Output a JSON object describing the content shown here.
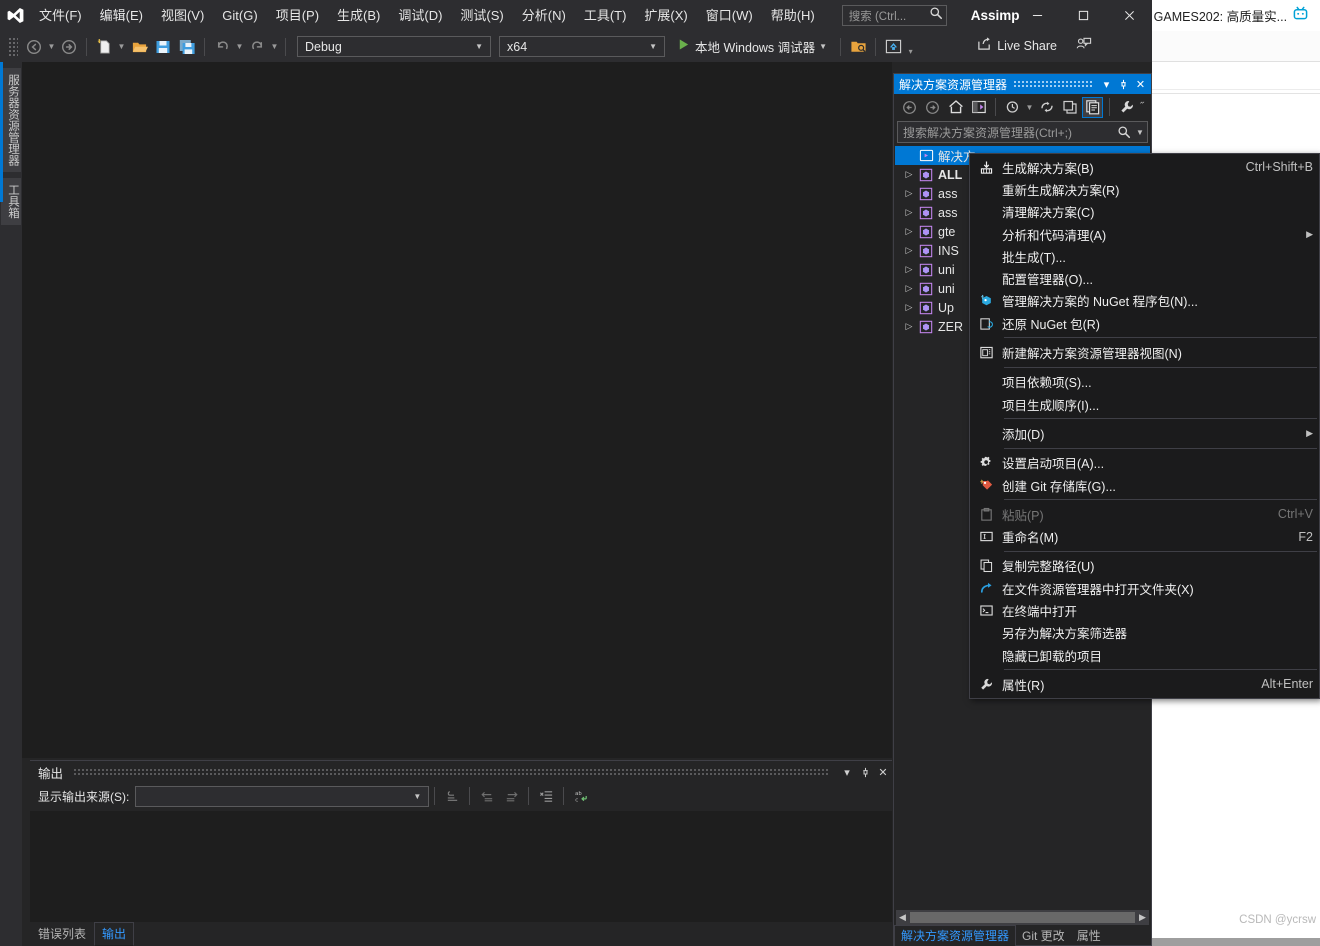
{
  "app": {
    "solution_name": "Assimp",
    "logo_icon": "visual-studio-logo-icon"
  },
  "menu": {
    "items": [
      {
        "label": "文件(F)"
      },
      {
        "label": "编辑(E)"
      },
      {
        "label": "视图(V)"
      },
      {
        "label": "Git(G)"
      },
      {
        "label": "项目(P)"
      },
      {
        "label": "生成(B)"
      },
      {
        "label": "调试(D)"
      },
      {
        "label": "测试(S)"
      },
      {
        "label": "分析(N)"
      },
      {
        "label": "工具(T)"
      },
      {
        "label": "扩展(X)"
      },
      {
        "label": "窗口(W)"
      },
      {
        "label": "帮助(H)"
      }
    ],
    "search_placeholder": "搜索 (Ctrl...",
    "search_icon": "search-icon"
  },
  "window_controls": {
    "minimize": "—",
    "maximize": "□",
    "close": "✕"
  },
  "toolbar": {
    "nav_back_icon": "navigate-back-icon",
    "nav_forward_icon": "navigate-forward-icon",
    "new_item_icon": "new-item-icon",
    "open_file_icon": "open-file-icon",
    "save_icon": "save-icon",
    "save_all_icon": "save-all-icon",
    "undo_icon": "undo-icon",
    "redo_icon": "redo-icon",
    "configuration": "Debug",
    "platform": "x64",
    "run_target": "本地 Windows 调试器",
    "run_icon": "play-icon",
    "select_startup_icon": "startup-project-icon",
    "screenshot_icon": "live-visual-tree-icon",
    "overflow_icon": "toolbar-overflow-icon",
    "live_share": "Live Share",
    "live_share_icon": "live-share-icon",
    "feedback_icon": "send-feedback-icon"
  },
  "left_dock": {
    "tabs": [
      {
        "label": "服务器资源管理器"
      },
      {
        "label": "工具箱"
      }
    ]
  },
  "solution_explorer": {
    "title": "解决方案资源管理器",
    "header_buttons": {
      "dropdown": "▾",
      "pin": "pin-icon",
      "close": "✕"
    },
    "toolbar_icons": [
      "back-icon",
      "forward-icon",
      "home-icon",
      "solution-explorer-icon",
      "pending-changes-icon",
      "refresh-icon",
      "collapse-all-icon",
      "show-all-files-icon",
      "properties-wrench-icon",
      "overflow-icon"
    ],
    "search_placeholder": "搜索解决方案资源管理器(Ctrl+;)",
    "search_icon": "search-icon",
    "search_dropdown_icon": "chevron-down-icon",
    "tree": [
      {
        "label": "解决方",
        "icon": "solution-icon",
        "selected": true,
        "bold": false,
        "expander": ""
      },
      {
        "label": "ALL",
        "icon": "cpp-project-icon",
        "selected": false,
        "bold": true,
        "expander": "▷"
      },
      {
        "label": "ass",
        "icon": "cpp-project-icon",
        "selected": false,
        "bold": false,
        "expander": "▷"
      },
      {
        "label": "ass",
        "icon": "cpp-project-icon",
        "selected": false,
        "bold": false,
        "expander": "▷"
      },
      {
        "label": "gte",
        "icon": "cpp-project-icon",
        "selected": false,
        "bold": false,
        "expander": "▷"
      },
      {
        "label": "INS",
        "icon": "cpp-project-icon",
        "selected": false,
        "bold": false,
        "expander": "▷"
      },
      {
        "label": "uni",
        "icon": "cpp-project-icon",
        "selected": false,
        "bold": false,
        "expander": "▷"
      },
      {
        "label": "uni",
        "icon": "cpp-project-icon",
        "selected": false,
        "bold": false,
        "expander": "▷"
      },
      {
        "label": "Up",
        "icon": "cpp-project-icon",
        "selected": false,
        "bold": false,
        "expander": "▷"
      },
      {
        "label": "ZER",
        "icon": "cpp-project-icon",
        "selected": false,
        "bold": false,
        "expander": "▷"
      }
    ],
    "hscroll": {
      "left_arrow": "◀",
      "right_arrow": "▶"
    },
    "tabs": [
      {
        "label": "解决方案资源管理器",
        "active": true
      },
      {
        "label": "Git 更改",
        "active": false
      },
      {
        "label": "属性",
        "active": false
      }
    ]
  },
  "context_menu": {
    "items": [
      {
        "label": "生成解决方案(B)",
        "shortcut": "Ctrl+Shift+B",
        "icon": "build-solution-icon",
        "submenu": false,
        "disabled": false,
        "sep_after": false
      },
      {
        "label": "重新生成解决方案(R)",
        "shortcut": "",
        "icon": "",
        "submenu": false,
        "disabled": false,
        "sep_after": false
      },
      {
        "label": "清理解决方案(C)",
        "shortcut": "",
        "icon": "",
        "submenu": false,
        "disabled": false,
        "sep_after": false
      },
      {
        "label": "分析和代码清理(A)",
        "shortcut": "",
        "icon": "",
        "submenu": true,
        "disabled": false,
        "sep_after": false
      },
      {
        "label": "批生成(T)...",
        "shortcut": "",
        "icon": "",
        "submenu": false,
        "disabled": false,
        "sep_after": false
      },
      {
        "label": "配置管理器(O)...",
        "shortcut": "",
        "icon": "",
        "submenu": false,
        "disabled": false,
        "sep_after": false
      },
      {
        "label": "管理解决方案的 NuGet 程序包(N)...",
        "shortcut": "",
        "icon": "nuget-manage-icon",
        "submenu": false,
        "disabled": false,
        "sep_after": false
      },
      {
        "label": "还原 NuGet 包(R)",
        "shortcut": "",
        "icon": "nuget-restore-icon",
        "submenu": false,
        "disabled": false,
        "sep_after": true
      },
      {
        "label": "新建解决方案资源管理器视图(N)",
        "shortcut": "",
        "icon": "new-solution-view-icon",
        "submenu": false,
        "disabled": false,
        "sep_after": true
      },
      {
        "label": "项目依赖项(S)...",
        "shortcut": "",
        "icon": "",
        "submenu": false,
        "disabled": false,
        "sep_after": false
      },
      {
        "label": "项目生成顺序(I)...",
        "shortcut": "",
        "icon": "",
        "submenu": false,
        "disabled": false,
        "sep_after": true
      },
      {
        "label": "添加(D)",
        "shortcut": "",
        "icon": "",
        "submenu": true,
        "disabled": false,
        "sep_after": true
      },
      {
        "label": "设置启动项目(A)...",
        "shortcut": "",
        "icon": "gear-icon",
        "submenu": false,
        "disabled": false,
        "sep_after": false
      },
      {
        "label": "创建 Git 存储库(G)...",
        "shortcut": "",
        "icon": "git-repo-icon",
        "submenu": false,
        "disabled": false,
        "sep_after": true
      },
      {
        "label": "粘贴(P)",
        "shortcut": "Ctrl+V",
        "icon": "paste-icon",
        "submenu": false,
        "disabled": true,
        "sep_after": false
      },
      {
        "label": "重命名(M)",
        "shortcut": "F2",
        "icon": "rename-icon",
        "submenu": false,
        "disabled": false,
        "sep_after": true
      },
      {
        "label": "复制完整路径(U)",
        "shortcut": "",
        "icon": "copy-path-icon",
        "submenu": false,
        "disabled": false,
        "sep_after": false
      },
      {
        "label": "在文件资源管理器中打开文件夹(X)",
        "shortcut": "",
        "icon": "open-folder-icon",
        "submenu": false,
        "disabled": false,
        "sep_after": false
      },
      {
        "label": "在终端中打开",
        "shortcut": "",
        "icon": "terminal-icon",
        "submenu": false,
        "disabled": false,
        "sep_after": false
      },
      {
        "label": "另存为解决方案筛选器",
        "shortcut": "",
        "icon": "",
        "submenu": false,
        "disabled": false,
        "sep_after": false
      },
      {
        "label": "隐藏已卸载的项目",
        "shortcut": "",
        "icon": "",
        "submenu": false,
        "disabled": false,
        "sep_after": true
      },
      {
        "label": "属性(R)",
        "shortcut": "Alt+Enter",
        "icon": "wrench-icon",
        "submenu": false,
        "disabled": false,
        "sep_after": false
      }
    ]
  },
  "output_panel": {
    "title": "输出",
    "source_label": "显示输出来源(S):",
    "source_value": "",
    "header_buttons": {
      "dropdown": "▾",
      "pin": "pin-icon",
      "close": "✕"
    },
    "tool_icons": [
      "clear-output-icon",
      "go-to-previous-icon",
      "go-to-next-icon",
      "toggle-messages-icon",
      "word-wrap-icon"
    ],
    "tabs": [
      {
        "label": "错误列表",
        "active": false
      },
      {
        "label": "输出",
        "active": true
      }
    ]
  },
  "browser": {
    "tab_title": "GAMES202: 高质量实...",
    "favicon": "bilibili-icon",
    "chevron": "›"
  },
  "watermark": "CSDN @ycrsw",
  "colors": {
    "accent": "#0078d4",
    "chrome": "#2d2d30",
    "panel": "#252526",
    "editor": "#1e1e1e",
    "menu_bg": "#1b1b1c",
    "link": "#3399ff"
  }
}
